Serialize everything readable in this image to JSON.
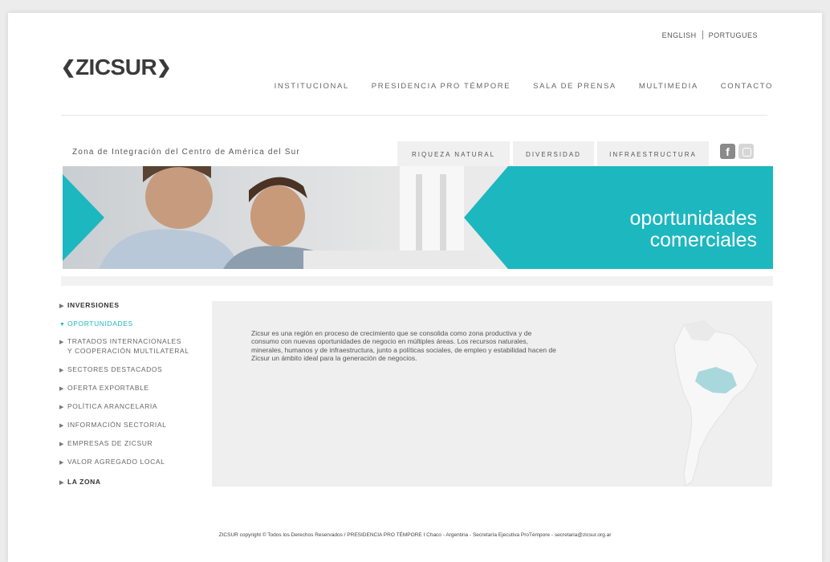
{
  "lang": {
    "english": "ENGLISH",
    "portugues": "PORTUGUES"
  },
  "logo": {
    "text": "ZICSUR"
  },
  "nav": [
    "INSTITUCIONAL",
    "PRESIDENCIA PRO TÉMPORE",
    "SALA DE PRENSA",
    "MULTIMEDIA",
    "CONTACTO"
  ],
  "tagline": "Zona de Integración del Centro de América del Sur",
  "tabs": [
    "RIQUEZA NATURAL",
    "DIVERSIDAD",
    "INFRAESTRUCTURA"
  ],
  "social": {
    "facebook": "f"
  },
  "banner": {
    "line1": "oportunidades",
    "line2": "comerciales"
  },
  "sidebar": {
    "items": [
      {
        "label": "INVERSIONES"
      },
      {
        "label": "OPORTUNIDADES"
      },
      {
        "label": "TRATADOS INTERNACIONALES",
        "label2": "Y COOPERACIÓN MULTILATERAL"
      },
      {
        "label": "SECTORES DESTACADOS"
      },
      {
        "label": "OFERTA EXPORTABLE"
      },
      {
        "label": "POLÍTICA ARANCELARIA"
      },
      {
        "label": "INFORMACIÓN SECTORIAL"
      },
      {
        "label": "EMPRESAS DE ZICSUR"
      },
      {
        "label": "VALOR AGREGADO LOCAL"
      },
      {
        "label": "LA ZONA"
      }
    ]
  },
  "content": {
    "text": "Zicsur es una región en proceso de crecimiento que se consolida como zona productiva y de consumo con nuevas oportunidades de negocio en múltiples áreas. Los recursos naturales, minerales, humanos y de infraestructura, junto a políticas sociales, de empleo y estabilidad hacen de Zicsur un ámbito ideal para la generación de negocios."
  },
  "footer": "ZICSUR copyright © Todos los Derechos Reservados / PRESIDENCIA PRO TÉMPORE I Chaco - Argentina - Secretaría Ejecutiva ProTémpore - secretaria@zicsur.org.ar",
  "colors": {
    "accent": "#1db7c0",
    "map": "#a9d8dc"
  }
}
